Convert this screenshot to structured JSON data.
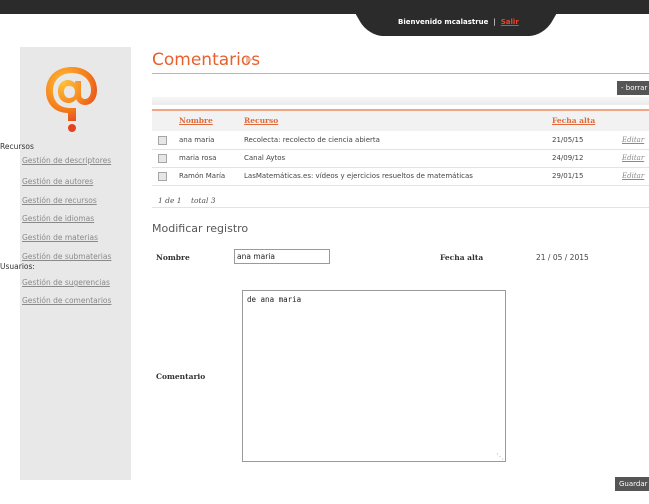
{
  "topbar": {
    "welcome": "Bienvenido mcalastrue",
    "separator": "|",
    "logout": "Salir"
  },
  "sidebar": {
    "logo_icon": "at-sign-question-logo",
    "sections": [
      {
        "heading": "Recursos",
        "links": [
          "Gestión de descriptores",
          "Gestión de autores",
          "Gestión de recursos",
          "Gestión de idiomas",
          "Gestión de materias",
          "Gestión de submaterias"
        ]
      },
      {
        "heading": "Usuarios:",
        "links": [
          "Gestión de sugerencias",
          "Gestión de comentarios"
        ]
      }
    ]
  },
  "main": {
    "title": "Comentarios",
    "delete_button": "- borrar",
    "table": {
      "headers": [
        "Nombre",
        "Recurso",
        "Fecha alta"
      ],
      "rows": [
        {
          "nombre": "ana maria",
          "recurso": "Recolecta: recolecto de ciencia abierta",
          "fecha": "21/05/15",
          "action": "Editar"
        },
        {
          "nombre": "maria rosa",
          "recurso": "Canal Aytos",
          "fecha": "24/09/12",
          "action": "Editar"
        },
        {
          "nombre": "Ramón María",
          "recurso": "LasMatemáticas.es: vídeos y ejercicios resueltos de matemáticas",
          "fecha": "29/01/15",
          "action": "Editar"
        }
      ],
      "pager": {
        "page": "1 de 1",
        "total": "total 3"
      }
    },
    "form": {
      "title": "Modificar registro",
      "name_label": "Nombre",
      "name_value": "ana maria",
      "date_label": "Fecha alta",
      "date_value": "21 / 05 / 2015",
      "comment_label": "Comentario",
      "comment_value": "de ana maria",
      "save_button": "Guardar"
    }
  },
  "colors": {
    "accent": "#e8602c",
    "dark": "#2b2b2b",
    "sidebar_bg": "#e8e8e8"
  }
}
